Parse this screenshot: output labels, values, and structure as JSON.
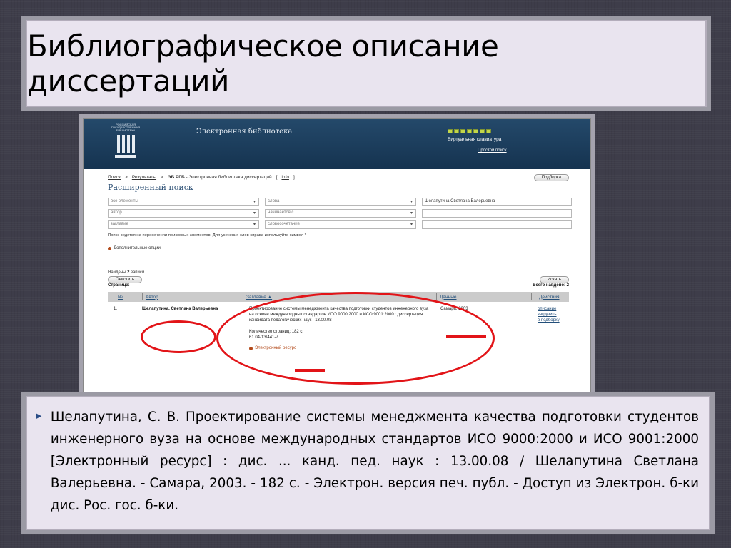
{
  "slide": {
    "title": "Библиографическое описание диссертаций",
    "citation": "Шелапутина, С. В. Проектирование системы менеджмента качества подготовки студентов инженерного вуза на основе международных стандартов ИСО 9000:2000 и ИСО 9001:2000 [Электронный ресурс] : дис. ... канд. пед. наук : 13.00.08 / Шелапутина Светлана Валерьевна. - Самара, 2003. - 182 с. - Электрон. версия печ. публ. - Доступ из Электрон. б-ки дис. Рос. гос. б-ки.",
    "bullet_color": "#2a4d86",
    "annotation_color": "#e21418"
  },
  "screenshot": {
    "header": {
      "logo_text": "РОССИЙСКАЯ ГОСУДАРСТВЕННАЯ БИБЛИОТЕКА",
      "title": "Электронная библиотека",
      "keyboard_label": "Виртуальная клавиатура",
      "simple_search": "Простой поиск"
    },
    "breadcrumb": {
      "search": "Поиск",
      "results": "Результаты",
      "current": "ЭБ РГБ",
      "current_rest": " - Электронная библиотека диссертаций",
      "info": "info"
    },
    "buttons": {
      "subscribe": "Подборка",
      "clear": "Очистить",
      "search": "Искать"
    },
    "adv_title": "Расширенный поиск",
    "form": {
      "row1": {
        "field": "все элементы",
        "op": "слова",
        "value": "Шелапутина Светлана Валерьевна"
      },
      "row2": {
        "field": "автор",
        "op": "начинается с",
        "value": ""
      },
      "row3": {
        "field": "заглавие",
        "op": "словосочетание",
        "value": ""
      }
    },
    "hint": "Поиск ведется на пересечении поисковых элементов. Для усечения слов справа используйте символ *",
    "extra_options": "Дополнительные опции",
    "found_prefix": "Найдены",
    "found_count": "2",
    "found_suffix": "записи.",
    "pages_label": "Страница:",
    "total_label": "Всего найдено: 2",
    "columns": {
      "num": "№",
      "author": "Автор",
      "title": "Заглавие ▲",
      "data": "Данные",
      "actions": "Действия"
    },
    "result": {
      "num": "1.",
      "author": "Шелапутина, Светлана Валерьевна",
      "title": "Проектирование системы менеджмента качества подготовки студентов инженерного вуза на основе международных стандартов ИСО 9000:2000 и ИСО 9001:2000 : диссертация ... кандидата педагогических наук : 13.00.08",
      "pages": "Количество страниц: 182 с.",
      "code": "61 04-13/441-7",
      "eres": "Электронный ресурс",
      "data": "Самара, 2003",
      "action1": "описание",
      "action2": "загрузить",
      "action3": "в подборку"
    }
  }
}
